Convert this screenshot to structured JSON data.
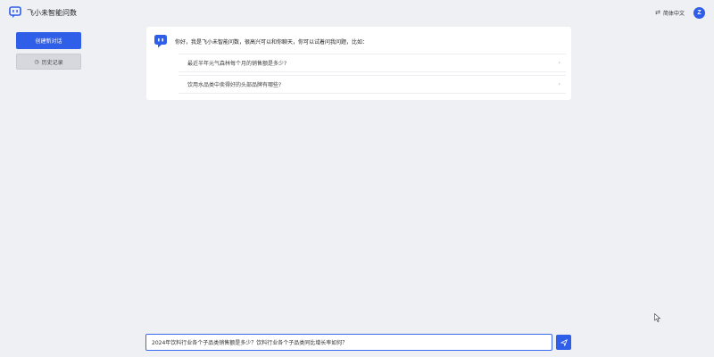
{
  "header": {
    "brand_name": "飞小未智能问数",
    "language_label": "简体中文",
    "avatar_letter": "Z"
  },
  "sidebar": {
    "new_chat_label": "创建新对话",
    "history_label": "历史记录"
  },
  "welcome": {
    "greeting": "你好，我是飞小未智能问数，很高兴可以和你聊天，你可以试着问我问题，比如：",
    "suggestions": [
      "最近半年元气森林每个月的销售额是多少?",
      "饮用水品类中卖得好的头部品牌有哪些?"
    ]
  },
  "composer": {
    "input_value": "2024年饮料行业各个子品类销售额是多少？饮料行业各个子品类同比增长率如何？"
  },
  "colors": {
    "accent": "#2f5ee8",
    "background": "#eef0f4"
  },
  "icons": {
    "brand": "chat-bubble-icon",
    "language": "translate-icon",
    "history": "clock-icon",
    "suggestion_arrow": "chevron-right-icon",
    "send": "send-icon",
    "cursor": "mouse-pointer-icon"
  }
}
